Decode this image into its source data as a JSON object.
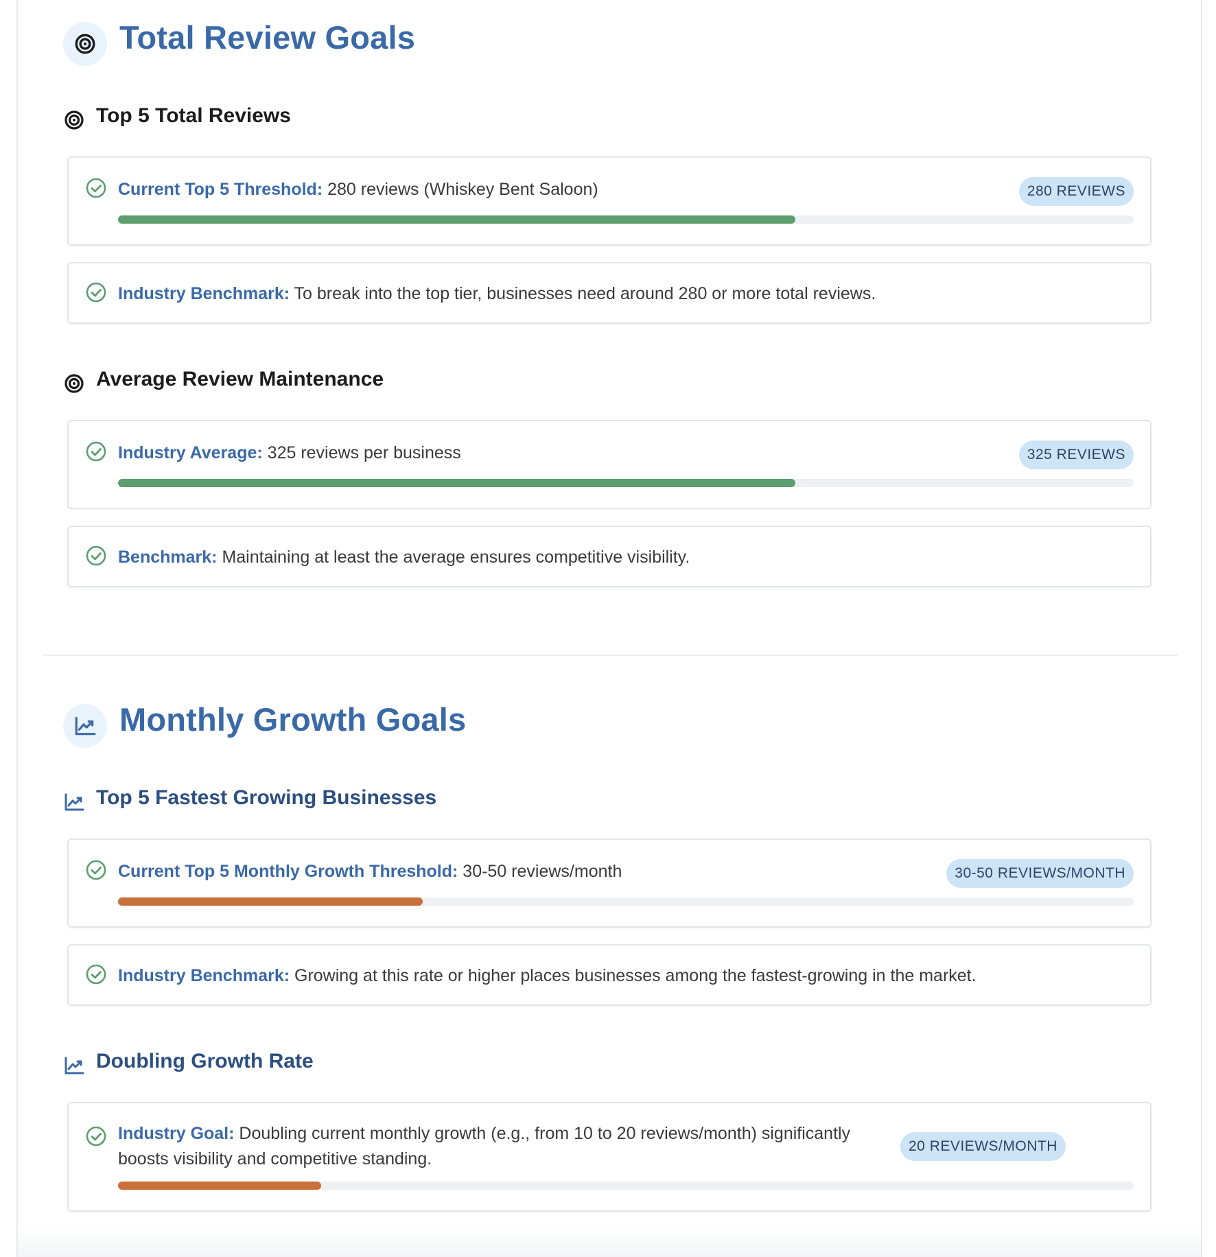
{
  "sections": [
    {
      "title": "Total Review Goals",
      "icon": "target-icon",
      "subsections": [
        {
          "title": "Top 5 Total Reviews",
          "icon": "target-icon",
          "cards": [
            {
              "label": "Current Top 5 Threshold:",
              "text": " 280 reviews (Whiskey Bent Saloon)",
              "badge": "280 REVIEWS",
              "progress": 0.667,
              "bar_color": "#5c9e6e"
            },
            {
              "label": "Industry Benchmark:",
              "text": " To break into the top tier, businesses need around 280 or more total reviews."
            }
          ]
        },
        {
          "title": "Average Review Maintenance",
          "icon": "target-icon",
          "cards": [
            {
              "label": "Industry Average:",
              "text": " 325 reviews per business",
              "badge": "325 REVIEWS",
              "progress": 0.667,
              "bar_color": "#5c9e6e"
            },
            {
              "label": "Benchmark:",
              "text": " Maintaining at least the average ensures competitive visibility."
            }
          ]
        }
      ]
    },
    {
      "title": "Monthly Growth Goals",
      "icon": "trending-up-icon",
      "subsections": [
        {
          "title": "Top 5 Fastest Growing Businesses",
          "icon": "trending-up-icon",
          "cards": [
            {
              "label": "Current Top 5 Monthly Growth Threshold:",
              "text": " 30-50 reviews/month",
              "badge": "30-50 REVIEWS/MONTH",
              "progress": 0.3,
              "bar_color": "#c9703a"
            },
            {
              "label": "Industry Benchmark:",
              "text": " Growing at this rate or higher places businesses among the fastest-growing in the market."
            }
          ]
        },
        {
          "title": "Doubling Growth Rate",
          "icon": "trending-up-icon",
          "cards": [
            {
              "label": "Industry Goal:",
              "text": " Doubling current monthly growth (e.g., from 10 to 20 reviews/month) significantly boosts visibility and competitive standing.",
              "badge": "20 REVIEWS/MONTH",
              "progress": 0.2,
              "bar_color": "#c9703a"
            }
          ]
        }
      ]
    }
  ]
}
